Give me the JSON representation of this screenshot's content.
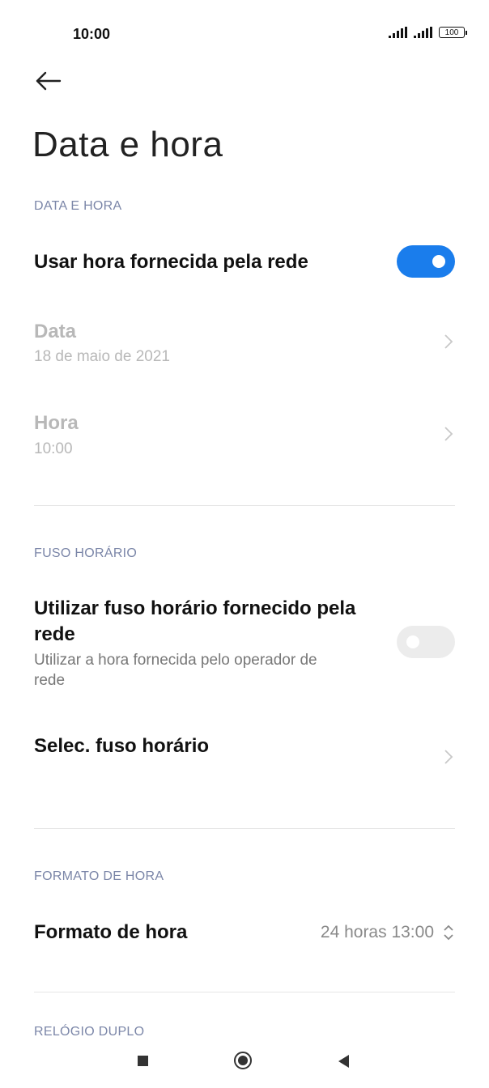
{
  "status_bar": {
    "time": "10:00",
    "battery": "100"
  },
  "page": {
    "title": "Data e hora"
  },
  "sections": {
    "datetime": {
      "header": "DATA E HORA",
      "network_time": {
        "title": "Usar hora fornecida pela rede",
        "enabled": true
      },
      "date": {
        "title": "Data",
        "value": "18 de maio de 2021"
      },
      "time": {
        "title": "Hora",
        "value": "10:00"
      }
    },
    "timezone": {
      "header": "FUSO HORÁRIO",
      "network_tz": {
        "title_line1": "Utilizar fuso horário fornecido pela",
        "title_line2": "rede",
        "subtitle_line1": "Utilizar a hora fornecida pelo operador de",
        "subtitle_line2": "rede",
        "enabled": false
      },
      "select_tz": {
        "title": "Selec. fuso horário"
      }
    },
    "time_format": {
      "header": "FORMATO DE HORA",
      "format": {
        "title": "Formato de hora",
        "value": "24 horas 13:00"
      }
    },
    "dual_clock": {
      "header": "RELÓGIO DUPLO"
    }
  },
  "colors": {
    "accent": "#1a7dec",
    "section_header": "#7b86a8",
    "disabled_text": "#b8b8b8"
  }
}
